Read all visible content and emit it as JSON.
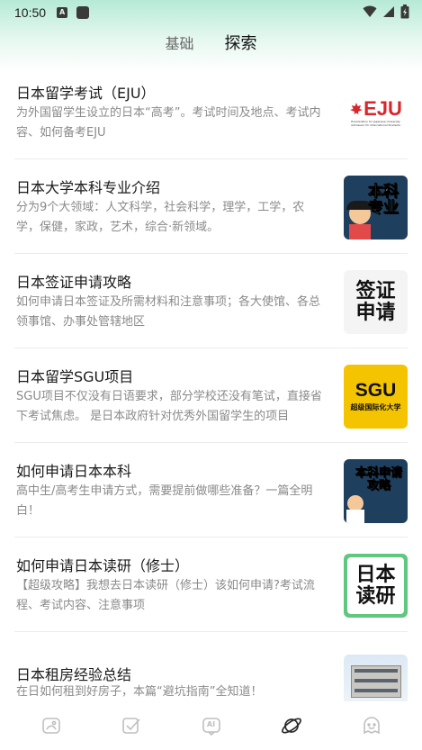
{
  "status": {
    "time": "10:50",
    "a_icon": "A"
  },
  "tabs": [
    {
      "label": "基础",
      "active": false
    },
    {
      "label": "探索",
      "active": true
    }
  ],
  "articles": [
    {
      "title": "日本留学考试（EJU）",
      "desc": "为外国留学生设立的日本“高考”。考试时间及地点、考试内容、如何备考EJU",
      "thumb": {
        "text": "EJU",
        "sub": "Examination for Japanese University Admission for International Students",
        "icon": "eju-logo"
      }
    },
    {
      "title": "日本大学本科专业介绍",
      "desc": "分为9个大领域：人文科学，社会科学，理学，工学，农学，保健，家政，艺术，综合·新领域。",
      "thumb": {
        "text": "本科专业",
        "icon": "undergrad-major-illustration"
      }
    },
    {
      "title": "日本签证申请攻略",
      "desc": "如何申请日本签证及所需材料和注意事项；各大使馆、各总领事馆、办事处管辖地区",
      "thumb": {
        "text": "签证申请",
        "icon": "visa-text-image"
      }
    },
    {
      "title": "日本留学SGU项目",
      "desc": "SGU项目不仅没有日语要求，部分学校还没有笔试，直接省下考试焦虑。 是日本政府针对优秀外国留学生的项目",
      "thumb": {
        "text": "SGU",
        "sub": "超级国际化大学",
        "icon": "sgu-logo"
      }
    },
    {
      "title": "如何申请日本本科",
      "desc": "高中生/高考生申请方式，需要提前做哪些准备？一篇全明白！",
      "thumb": {
        "text": "本科申请攻略",
        "icon": "undergrad-apply-illustration"
      }
    },
    {
      "title": "如何申请日本读研（修士）",
      "desc": "【超级攻略】我想去日本读研（修士）该如何申请?考试流程、考试内容、注意事项",
      "thumb": {
        "text": "日本读研",
        "icon": "grad-school-text-image"
      }
    },
    {
      "title": "日本租房经验总结",
      "desc": "在日如何租到好房子，本篇“避坑指南”全知道！",
      "thumb": {
        "text": "",
        "icon": "apartment-building-photo"
      }
    }
  ],
  "nav": [
    {
      "name": "nav-home",
      "icon": "image-card-icon"
    },
    {
      "name": "nav-tasks",
      "icon": "checkbox-icon"
    },
    {
      "name": "nav-ai",
      "icon": "ai-icon",
      "label": "AI"
    },
    {
      "name": "nav-explore",
      "icon": "planet-icon",
      "active": true
    },
    {
      "name": "nav-profile",
      "icon": "smiley-ghost-icon"
    }
  ],
  "colors": {
    "accent": "#7fd4b6",
    "header_gradient_top": "#b6ead6"
  }
}
